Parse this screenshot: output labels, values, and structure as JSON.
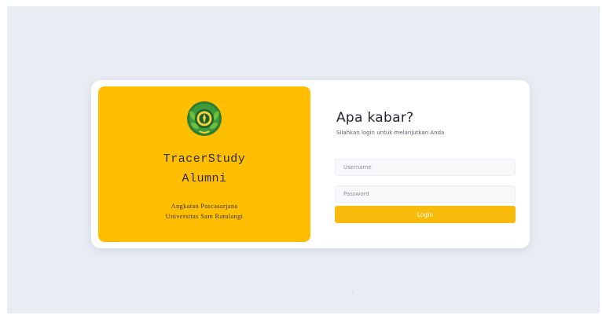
{
  "brand": {
    "title_line1": "TracerStudy",
    "title_line2": "Alumni",
    "subtitle_line1": "Angkatan Pascasarjana",
    "subtitle_line2": "Universitas Sam Ratulangi",
    "logo_icon": "university-seal-icon",
    "color": "#ffbf00"
  },
  "login": {
    "title": "Apa kabar?",
    "subtitle": "Silahkan login untuk melanjutkan Anda",
    "username_placeholder": "Username",
    "password_placeholder": "Password",
    "button_label": "Login",
    "accent_color": "#f8bb0b"
  },
  "footer": {
    "text": "·"
  }
}
